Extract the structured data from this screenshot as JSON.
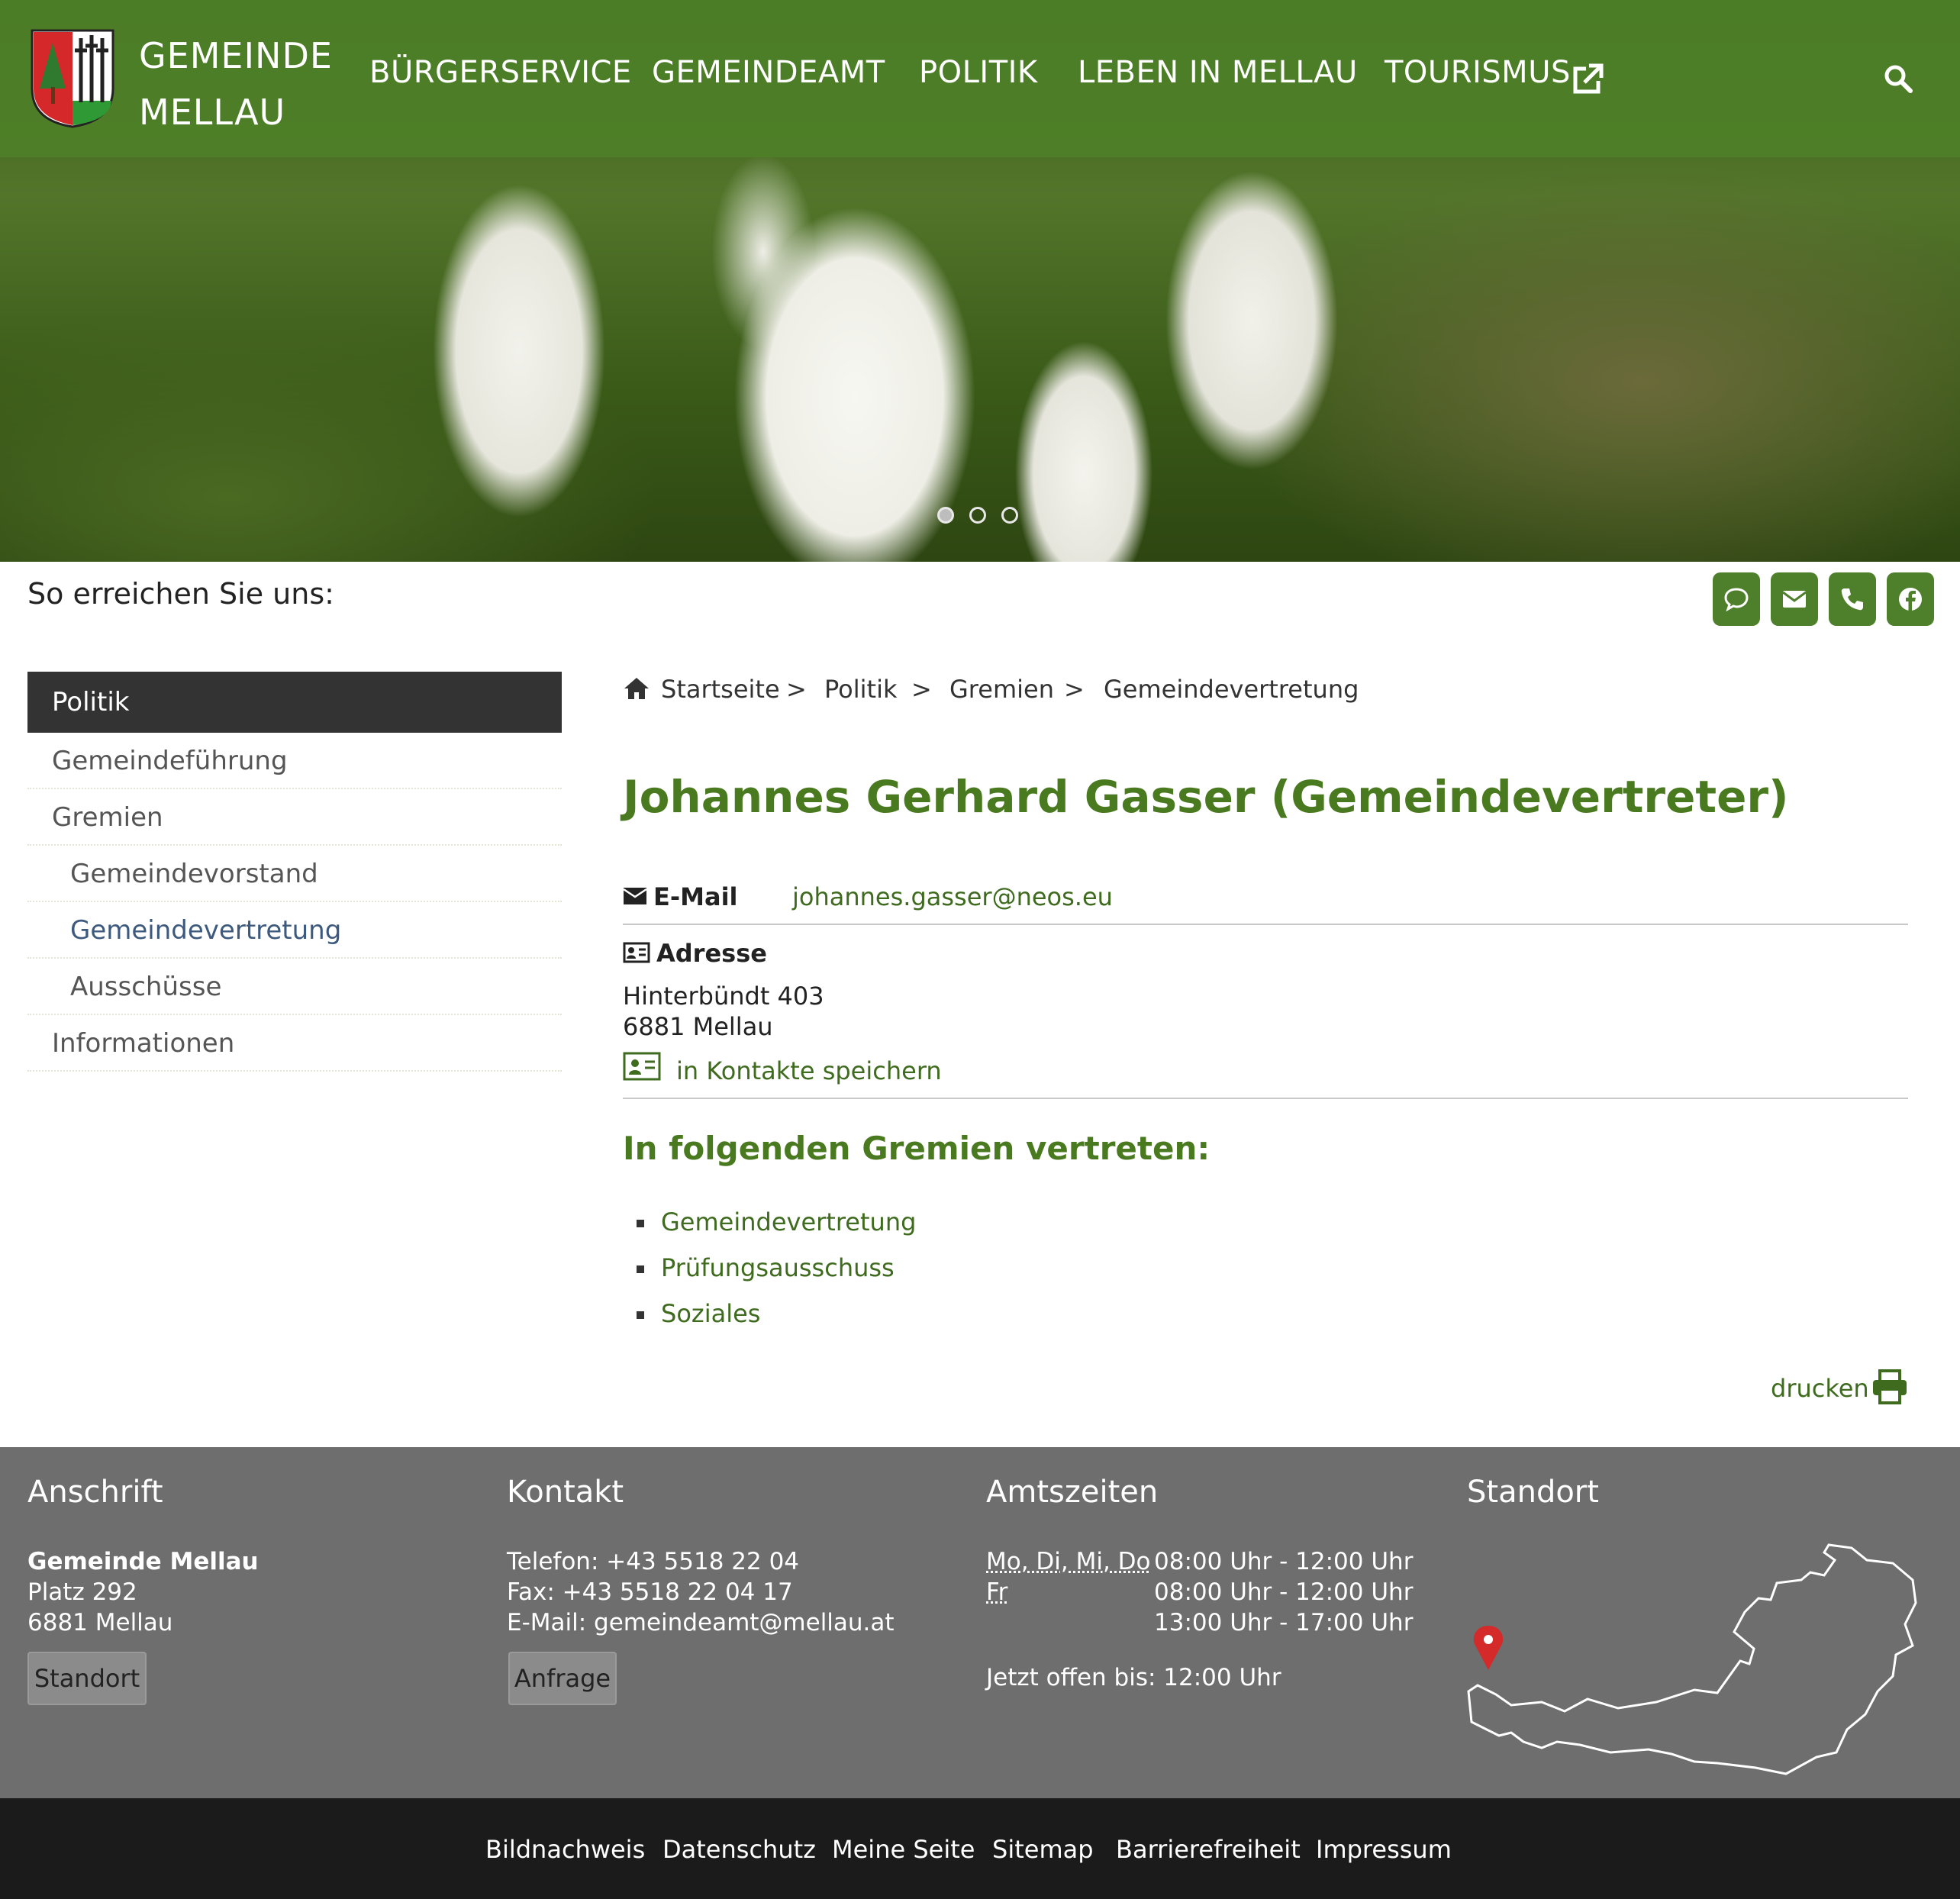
{
  "header": {
    "brand_line1": "GEMEINDE",
    "brand_line2": "MELLAU",
    "nav": [
      {
        "label": "BÜRGERSERVICE"
      },
      {
        "label": "GEMEINDEAMT"
      },
      {
        "label": "POLITIK"
      },
      {
        "label": "LEBEN IN MELLAU"
      },
      {
        "label": "TOURISMUS"
      }
    ],
    "accent": "#4e7f2a"
  },
  "contact_strip": {
    "label": "So erreichen Sie uns:",
    "icons": [
      "chat-icon",
      "envelope-icon",
      "phone-icon",
      "facebook-icon"
    ]
  },
  "sidebar": {
    "heading": "Politik",
    "items": [
      {
        "label": "Gemeindeführung"
      },
      {
        "label": "Gremien"
      },
      {
        "label": "Gemeindevorstand"
      },
      {
        "label": "Gemeindevertretung"
      },
      {
        "label": "Ausschüsse"
      },
      {
        "label": "Informationen"
      }
    ]
  },
  "breadcrumb": [
    "Startseite",
    "Politik",
    "Gremien",
    "Gemeindevertretung"
  ],
  "breadcrumb_sep": ">",
  "person": {
    "title": "Johannes Gerhard Gasser (Gemeindevertreter)",
    "email_label": "E-Mail",
    "email": "johannes.gasser@neos.eu",
    "address_label": "Adresse",
    "street": "Hinterbündt 403",
    "city": "6881 Mellau",
    "save_contact": "in Kontakte speichern",
    "committees_heading": "In folgenden Gremien vertreten:",
    "committees": [
      "Gemeindevertretung",
      "Prüfungsausschuss",
      "Soziales"
    ]
  },
  "print_label": "drucken",
  "footer": {
    "anschrift": {
      "heading": "Anschrift",
      "name": "Gemeinde Mellau",
      "street": "Platz 292",
      "city": "6881 Mellau",
      "button": "Standort"
    },
    "kontakt": {
      "heading": "Kontakt",
      "phone": "Telefon: +43 5518 22 04",
      "fax": "Fax: +43 5518 22 04 17",
      "email": "E-Mail: gemeindeamt@mellau.at",
      "button": "Anfrage"
    },
    "amtszeiten": {
      "heading": "Amtszeiten",
      "days1": "Mo, Di, Mi, Do",
      "days2": "Fr",
      "time1": "08:00 Uhr - 12:00 Uhr",
      "time2": "08:00 Uhr - 12:00 Uhr",
      "time3": "13:00 Uhr - 17:00 Uhr",
      "open_until": "Jetzt offen bis: 12:00 Uhr"
    },
    "standort": {
      "heading": "Standort"
    }
  },
  "bottom_links": [
    "Bildnachweis",
    "Datenschutz",
    "Meine Seite",
    "Sitemap",
    "Barrierefreiheit",
    "Impressum"
  ]
}
